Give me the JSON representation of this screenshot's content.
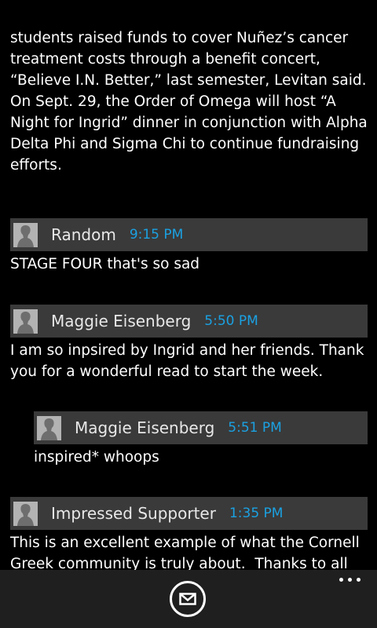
{
  "article": {
    "text": "students raised funds to cover Nuñez’s cancer treatment costs through a benefit concert, “Believe I.N. Better,” last semester, Levitan said. On Sept. 29, the Order of Omega will host “A Night for Ingrid” dinner in conjunction with Alpha Delta Phi and Sigma Chi to continue fundraising efforts."
  },
  "comments": [
    {
      "author": "Random",
      "time": "9:15 PM",
      "text": "STAGE FOUR that's so sad"
    },
    {
      "author": "Maggie Eisenberg",
      "time": "5:50 PM",
      "text": "I am so inpsired by Ingrid and her friends. Thank you for a wonderful read to start the week."
    },
    {
      "author": "Maggie Eisenberg",
      "time": "5:51 PM",
      "text": "inspired* whoops"
    },
    {
      "author": "Impressed Supporter",
      "time": "1:35 PM",
      "text": "This is an excellent example of what the Cornell Greek community is truly about.  Thanks to all that"
    }
  ],
  "app_bar": {
    "mail_icon": "mail-icon",
    "more_icon": "more-options-icon"
  }
}
